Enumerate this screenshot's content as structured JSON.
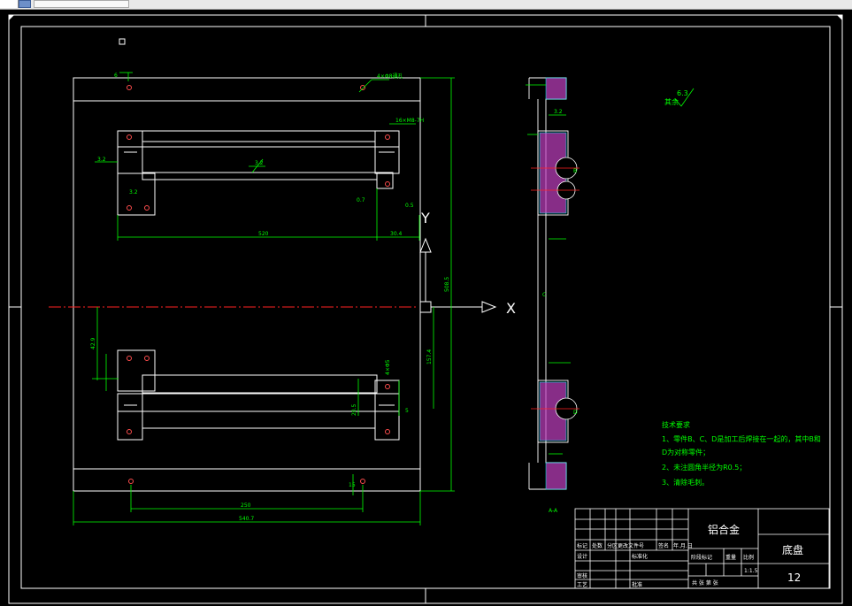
{
  "colors": {
    "background": "#000000",
    "outline": "#ffffff",
    "dimension": "#00ff00",
    "centerline": "#ff2222",
    "hatch": "#d946ef",
    "section": "#00ffff"
  },
  "toolbar": {
    "icon": "drawing-file-icon"
  },
  "axes": {
    "x_label": "X",
    "y_label": "Y"
  },
  "plan_view": {
    "top_left_label": "6",
    "chamfer_note": "4×Φ8通孔",
    "tap_note": "16×M8-7H",
    "roughness_a": "3.2",
    "roughness_b": "3.2",
    "rough_mid": "3.2",
    "dim_upper_span": "520",
    "dim_upper_right": "30.4",
    "dim_right_small_1": "0.7",
    "dim_right_small_2": "0.5",
    "dim_height_total": "508.5",
    "dim_height_half": "157.4",
    "dim_left_vertical": "42.9",
    "dim_lower_hole": "4×Φ5",
    "dim_lower_mid": "20.5",
    "dim_lower_right": "5",
    "dim_bottom_span": "250",
    "dim_bottom_total": "540.7",
    "dim_right_tiny": "15"
  },
  "section_view": {
    "label_c": "C",
    "label_b": "B",
    "label_d": "D",
    "roughness": "3.2",
    "section_mark": "A-A",
    "surface_note_label": "其余",
    "surface_note_value": "6.3"
  },
  "tech_requirements": {
    "title": "技术要求",
    "items": [
      "1、零件B、C、D是加工后焊接在一起的，其中B和",
      "D为对称零件；",
      "2、未注圆角半径为R0.5；",
      "3、清除毛刺。"
    ]
  },
  "title_block": {
    "material": "铝合金",
    "part_name": "底盘",
    "drawing_no": "12",
    "scale_label": "比例",
    "scale_value": "1:1.5",
    "weight_label": "重量",
    "stage_label": "阶段标记",
    "sheets_label": "共 张 第 张",
    "designer": "设计",
    "std": "标准化",
    "review": "审核",
    "process": "工艺",
    "approve": "批准",
    "mark": "标记",
    "count": "处数",
    "zone": "分区",
    "doc_no": "更改文件号",
    "signature": "签名",
    "date": "年.月.日"
  }
}
